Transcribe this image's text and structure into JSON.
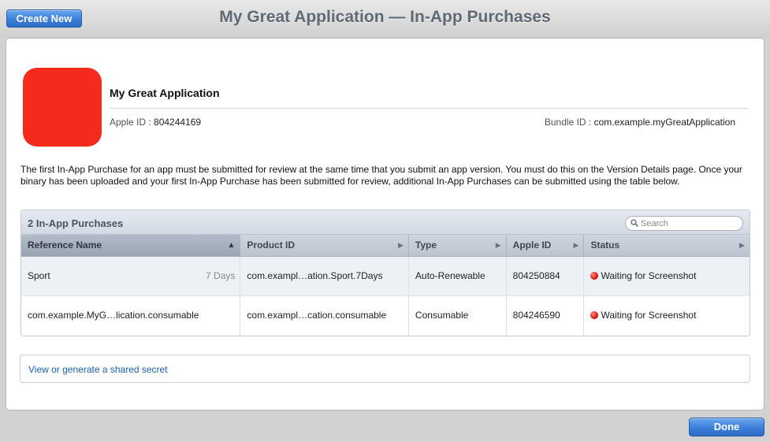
{
  "toolbar": {
    "create_new_label": "Create New",
    "done_label": "Done"
  },
  "window": {
    "title": "My Great Application — In-App Purchases"
  },
  "app": {
    "name": "My Great Application",
    "apple_id_label": "Apple ID : ",
    "apple_id": "804244169",
    "bundle_id_label": "Bundle ID : ",
    "bundle_id": "com.example.myGreatApplication",
    "icon_color": "#f52a1d"
  },
  "intro_text": "The first In-App Purchase for an app must be submitted for review at the same time that you submit an app version. You must do this on the Version Details page. Once your binary has been uploaded and your first In-App Purchase has been submitted for review, additional In-App Purchases can be submitted using the table below.",
  "table": {
    "title": "2 In-App Purchases",
    "search_placeholder": "Search",
    "columns": [
      "Reference Name",
      "Product ID",
      "Type",
      "Apple ID",
      "Status"
    ],
    "sort_column": "Reference Name",
    "rows": [
      {
        "reference_name": "Sport",
        "duration": "7 Days",
        "product_id": "com.exampl…ation.Sport.7Days",
        "type": "Auto-Renewable",
        "apple_id": "804250884",
        "status": "Waiting for Screenshot",
        "status_color": "#d41b10"
      },
      {
        "reference_name": "com.example.MyG…lication.consumable",
        "duration": "",
        "product_id": "com.exampl…cation.consumable",
        "type": "Consumable",
        "apple_id": "804246590",
        "status": "Waiting for Screenshot",
        "status_color": "#d41b10"
      }
    ]
  },
  "shared_secret": {
    "link_label": "View or generate a shared secret"
  },
  "colors": {
    "accent_blue": "#3b7fd9",
    "link_blue": "#1b5fae"
  }
}
